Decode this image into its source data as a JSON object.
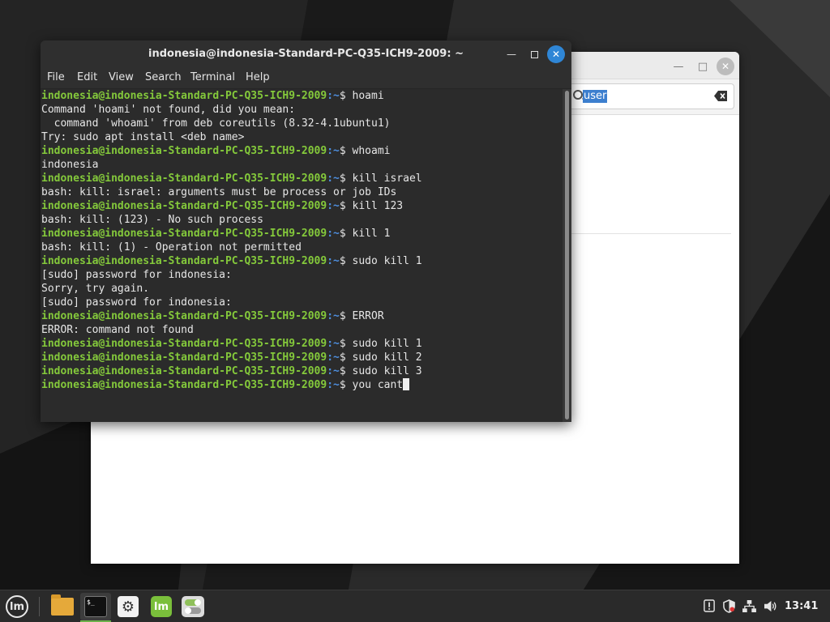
{
  "wallpaper": {
    "base": "#1b1b1b"
  },
  "background_window": {
    "search_value": "user"
  },
  "terminal": {
    "title": "indonesia@indonesia-Standard-PC-Q35-ICH9-2009: ~",
    "menu": [
      "File",
      "Edit",
      "View",
      "Search",
      "Terminal",
      "Help"
    ],
    "prompt_user": "indonesia@indonesia-Standard-PC-Q35-ICH9-2009",
    "prompt_path": ":~",
    "prompt_symbol": "$ ",
    "lines": [
      {
        "type": "cmd",
        "text": "hoami"
      },
      {
        "type": "out",
        "text": "Command 'hoami' not found, did you mean:"
      },
      {
        "type": "out",
        "text": "  command 'whoami' from deb coreutils (8.32-4.1ubuntu1)"
      },
      {
        "type": "out",
        "text": "Try: sudo apt install <deb name>"
      },
      {
        "type": "cmd",
        "text": "whoami"
      },
      {
        "type": "out",
        "text": "indonesia"
      },
      {
        "type": "cmd",
        "text": "kill israel"
      },
      {
        "type": "out",
        "text": "bash: kill: israel: arguments must be process or job IDs"
      },
      {
        "type": "cmd",
        "text": "kill 123"
      },
      {
        "type": "out",
        "text": "bash: kill: (123) - No such process"
      },
      {
        "type": "cmd",
        "text": "kill 1"
      },
      {
        "type": "out",
        "text": "bash: kill: (1) - Operation not permitted"
      },
      {
        "type": "cmd",
        "text": "sudo kill 1"
      },
      {
        "type": "out",
        "text": "[sudo] password for indonesia:"
      },
      {
        "type": "out",
        "text": "Sorry, try again."
      },
      {
        "type": "out",
        "text": "[sudo] password for indonesia:"
      },
      {
        "type": "cmd",
        "text": "ERROR"
      },
      {
        "type": "out",
        "text": "ERROR: command not found"
      },
      {
        "type": "cmd",
        "text": "sudo kill 1"
      },
      {
        "type": "cmd",
        "text": "sudo kill 2"
      },
      {
        "type": "cmd",
        "text": "sudo kill 3"
      },
      {
        "type": "current",
        "text": "you cant"
      }
    ]
  },
  "taskbar": {
    "clock": "13:41",
    "terminal_icon_text": "$_",
    "menu_logo": "lm",
    "mint_app_logo": "lm"
  },
  "colors": {
    "prompt_user": "#84c93b",
    "prompt_path": "#4e8fe0",
    "accent": "#2f86d6",
    "active_indicator": "#6bb14a"
  }
}
